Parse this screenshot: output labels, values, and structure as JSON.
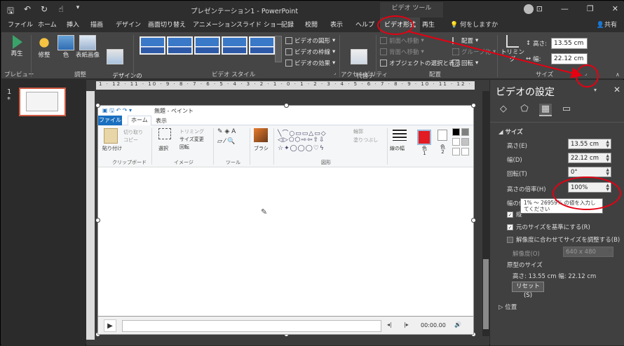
{
  "titlebar": {
    "title": "プレゼンテーション1  -  PowerPoint",
    "context_group": "ビデオ ツール",
    "qat": [
      "save-icon",
      "undo-icon",
      "redo-icon",
      "touch-mode-icon",
      "customize-icon"
    ]
  },
  "tabs": [
    "ファイル",
    "ホーム",
    "挿入",
    "描画",
    "デザイン",
    "画面切り替え",
    "アニメーション",
    "スライド ショー",
    "記録",
    "校閲",
    "表示",
    "ヘルプ",
    "ビデオ形式",
    "再生"
  ],
  "tell_me": "何をしますか",
  "share": "共有",
  "ribbon": {
    "preview": {
      "play": "再生",
      "label": "プレビュー"
    },
    "adjust": {
      "items": [
        "修整",
        "色",
        "表紙画像",
        "デザインの\nリセット"
      ],
      "label": "調整"
    },
    "video_styles": {
      "shape": "ビデオの図形",
      "border": "ビデオの枠線",
      "effects": "ビデオの効果",
      "label": "ビデオ スタイル"
    },
    "accessibility": {
      "alt_text": "代替テ\nキスト",
      "label": "アクセシビリティ"
    },
    "arrange": {
      "forward": "前面へ移動",
      "backward": "背面へ移動",
      "selection": "オブジェクトの選択と表示",
      "align": "配置",
      "group": "グループ化",
      "rotate": "回転",
      "label": "配置"
    },
    "size": {
      "crop": "トリミング",
      "height_label": "高さ:",
      "height": "13.55 cm",
      "width_label": "幅:",
      "width": "22.12 cm",
      "label": "サイズ"
    }
  },
  "slide_pane": {
    "number": "1",
    "star": "*"
  },
  "paint": {
    "title": "無題 - ペイント",
    "file_tab": "ファイル",
    "tabs": [
      "ホーム",
      "表示"
    ],
    "clipboard": {
      "paste": "貼り付け",
      "cut": "切り取り",
      "copy": "コピー",
      "label": "クリップボード"
    },
    "image": {
      "select": "選択",
      "crop": "トリミング",
      "resize": "サイズ変更",
      "rotate": "回転",
      "label": "イメージ"
    },
    "tools": {
      "label": "ツール"
    },
    "brush": "ブラシ",
    "shapes": {
      "outline": "輪郭",
      "fill": "塗りつぶし",
      "label": "図形"
    },
    "line_width": "線の幅",
    "color1": "色\n1",
    "color2": "色\n2"
  },
  "video_controls": {
    "time": "00:00.00"
  },
  "pane": {
    "title": "ビデオの設定",
    "section_size": "サイズ",
    "height_label": "高さ(E)",
    "height": "13.55 cm",
    "width_label": "幅(D)",
    "width": "22.12 cm",
    "rotation_label": "回転(T)",
    "rotation": "0°",
    "height_scale_label": "高さの倍率(H)",
    "height_scale": "100%",
    "width_scale_label": "幅の倍",
    "lock_aspect_short": "縦",
    "relative_original": "元のサイズを基準にする(R)",
    "best_scale": "解像度に合わせてサイズを調整する(B)",
    "resolution_label": "解像度(O)",
    "resolution": "640 x 480",
    "original_size_label": "原型のサイズ",
    "original_size": "高さ:   13.55 cm    幅:   22.12 cm",
    "reset": "リセット(S)",
    "section_position": "位置",
    "tooltip": "1% ～ 26959% の値を入力してください"
  },
  "colors": {
    "annotation": "#e60012",
    "paint_file_tab": "#1a6fbf",
    "selected_slide": "#d05b43"
  }
}
